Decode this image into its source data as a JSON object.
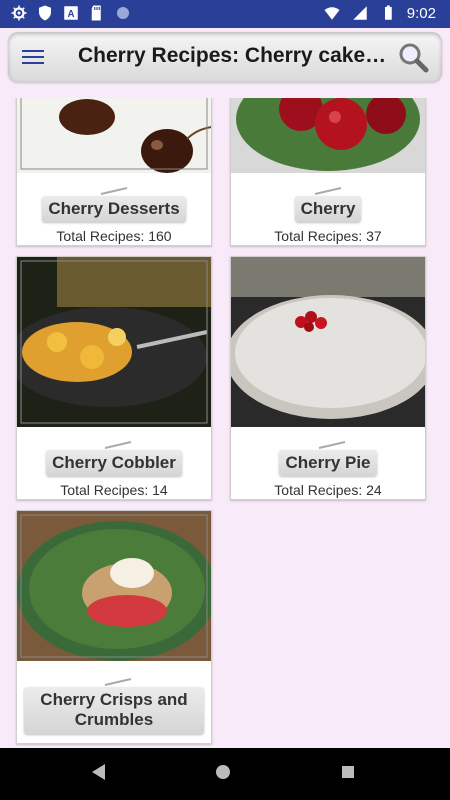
{
  "status": {
    "time": "9:02"
  },
  "appbar": {
    "title": "Cherry Recipes: Cherry cake,…"
  },
  "cards": [
    {
      "label": "Cherry Desserts",
      "count": "Total Recipes: 160"
    },
    {
      "label": "Cherry",
      "count": "Total Recipes: 37"
    },
    {
      "label": "Cherry Cobbler",
      "count": "Total Recipes: 14"
    },
    {
      "label": "Cherry Pie",
      "count": "Total Recipes: 24"
    },
    {
      "label": "Cherry Crisps and Crumbles"
    }
  ],
  "colors": {
    "statusbar": "#2a3f98",
    "background": "#f8eaf8"
  }
}
